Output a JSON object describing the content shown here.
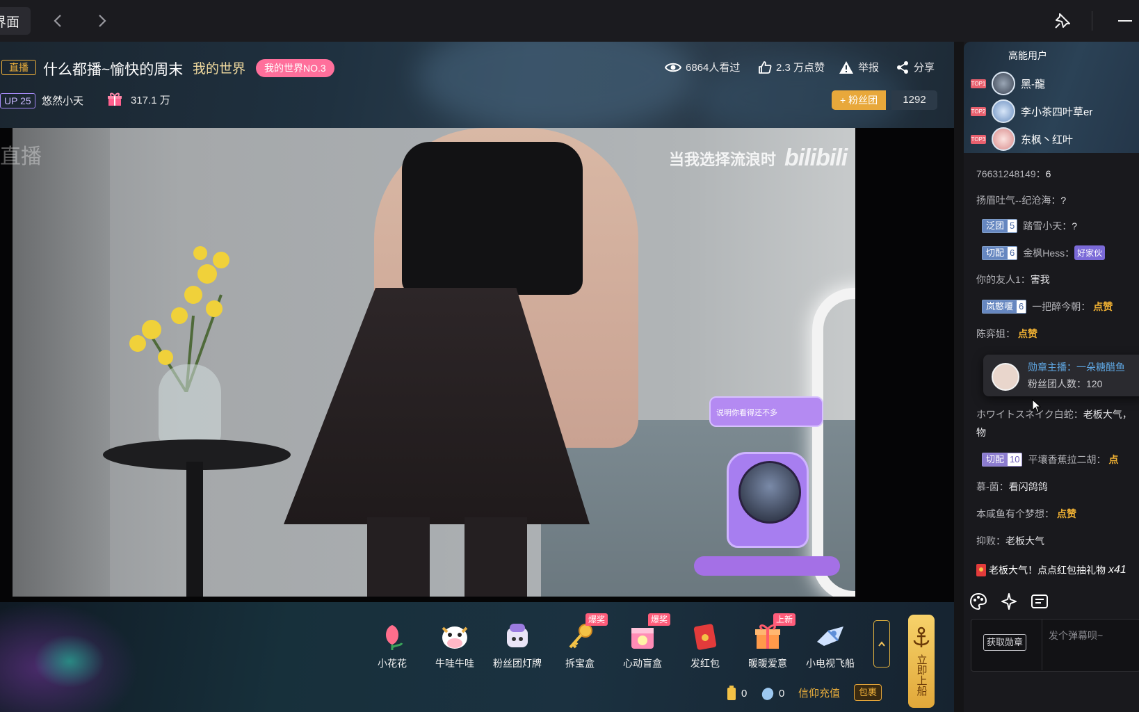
{
  "titlebar": {
    "tab_label": "界面"
  },
  "room": {
    "live_tag": "直播",
    "title": "什么都播~愉快的周末",
    "category": "我的世界",
    "rank_badge": "我的世界NO.3",
    "views": "6864人看过",
    "likes": "2.3 万点赞",
    "report": "举报",
    "share": "分享",
    "up_level": "UP 25",
    "host_name": "悠然小天",
    "gift_total": "317.1 万",
    "fan_club_button": "+ 粉丝团",
    "fan_club_count": "1292"
  },
  "video": {
    "watermark_text": "当我选择流浪时",
    "watermark_logo": "bilibili",
    "corner_mark": "直播",
    "bubble_text": "说明你看得还不多"
  },
  "gifts": [
    {
      "label": "小花花",
      "icon": "flower-icon",
      "tag": ""
    },
    {
      "label": "牛哇牛哇",
      "icon": "cow-icon",
      "tag": ""
    },
    {
      "label": "粉丝团灯牌",
      "icon": "fan-light-icon",
      "tag": ""
    },
    {
      "label": "拆宝盒",
      "icon": "key-icon",
      "tag": "爆奖"
    },
    {
      "label": "心动盲盒",
      "icon": "blind-box-icon",
      "tag": "爆奖"
    },
    {
      "label": "发红包",
      "icon": "red-envelope-icon",
      "tag": ""
    },
    {
      "label": "暖暖爱意",
      "icon": "gift-box-icon",
      "tag": "上新"
    },
    {
      "label": "小电视飞船",
      "icon": "tv-ship-icon",
      "tag": ""
    }
  ],
  "giftbar": {
    "board_button": "立即上船",
    "battery": "0",
    "silver": "0",
    "recharge": "信仰充值",
    "pack": "包裹"
  },
  "rank": {
    "tab": "高能用户",
    "users": [
      {
        "no": "TOP1",
        "name": "黑-龍"
      },
      {
        "no": "TOP2",
        "name": "李小茶四叶草er"
      },
      {
        "no": "TOP3",
        "name": "东枫丶红叶"
      }
    ]
  },
  "chat": {
    "m1": {
      "name": "76631248149：",
      "text": "6"
    },
    "m2": {
      "name": "扬眉吐气--纪沧海：",
      "text": "?"
    },
    "m3": {
      "medal": "泛团",
      "level": "5",
      "name": "踏雪小天：",
      "text": "?"
    },
    "m4": {
      "medal": "切配",
      "level": "6",
      "name": "金枫Hess：",
      "emote": "好家伙"
    },
    "m5": {
      "name": "你的友人1：",
      "text": "害我"
    },
    "m6": {
      "medal": "岚憨嗄",
      "level": "6",
      "name": "一把醉今朝：",
      "emote": "点赞"
    },
    "m7": {
      "name": "陈弈姐：",
      "emote": "点赞"
    },
    "m8": {
      "name": "ホワイトスネイク白蛇：",
      "text": "老板大气，",
      "text2": "物"
    },
    "m9": {
      "medal": "切配",
      "level": "10",
      "name": "平壤香蕉拉二胡：",
      "emote": "点"
    },
    "m10": {
      "name": "慕-菌：",
      "text": "看闪鸽鸽"
    },
    "m11": {
      "name": "本咸鱼有个梦想：",
      "emote": "点赞"
    },
    "m12": {
      "name": "抑败：",
      "text": "老板大气"
    },
    "m13": {
      "text": "老板大气！点点红包抽礼物",
      "multiplier": "x41"
    }
  },
  "tooltip": {
    "line1": "勋章主播：一朵糖醋鱼",
    "line2": "粉丝团人数：120"
  },
  "input": {
    "get_medal": "获取勋章",
    "placeholder": "发个弹幕呗~"
  }
}
